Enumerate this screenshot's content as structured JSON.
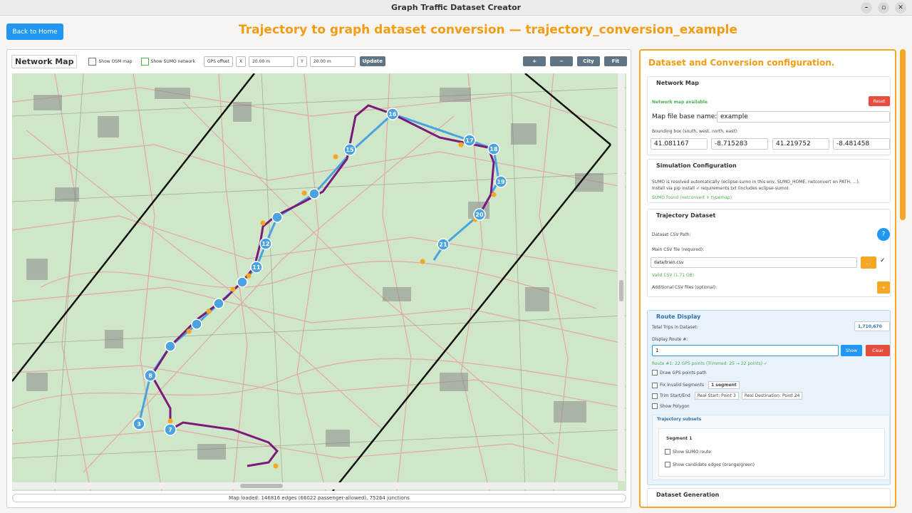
{
  "window": {
    "title": "Graph Traffic Dataset Creator",
    "minimize": "–",
    "maximize": "▫",
    "close": "✕"
  },
  "header": {
    "home_button": "Back to Home",
    "title": "Trajectory to graph dataset conversion — trajectory_conversion_example"
  },
  "map_toolbar": {
    "label": "Network Map",
    "show_osm": "Show OSM map",
    "show_sumo": "Show SUMO network",
    "gps_offset": "GPS offset",
    "x_label": "X",
    "x_value": "20.00 m",
    "y_label": "Y",
    "y_value": "20.00 m",
    "update": "Update",
    "zoom_in": "+",
    "zoom_out": "−",
    "city": "City",
    "fit": "Fit"
  },
  "map": {
    "status": "Map loaded: 146816 edges (66022 passenger-allowed), 75264 junctions",
    "point_labels": [
      "3",
      "7",
      "8",
      "11",
      "12",
      "15",
      "16",
      "17",
      "18",
      "19",
      "20",
      "21"
    ],
    "colors": {
      "background": "#cfe6c8",
      "roads": "#e3a3a3",
      "buildings": "#8a8a8a",
      "route": "#7b1a7b",
      "gps": "#4aa3df",
      "marker": "#f5a623",
      "bbox": "#111111"
    }
  },
  "config": {
    "title": "Dataset and Conversion configuration.",
    "network_map": {
      "heading": "Network Map",
      "status": "Network map available",
      "reset": "Reset",
      "base_name_label": "Map file base name:",
      "base_name_value": "example",
      "bbox_label": "Bounding box (south, west, north, east):",
      "bbox": [
        "41.081167",
        "-8.715283",
        "41.219752",
        "-8.481458"
      ]
    },
    "simulation": {
      "heading": "Simulation Configuration",
      "text1": "SUMO is resolved automatically (eclipse-sumo in this env, SUMO_HOME, netconvert on PATH, ...).",
      "text2": "Install via pip install -r requirements.txt (includes eclipse-sumo).",
      "status": "SUMO found (netconvert + typemap)"
    },
    "trajectory": {
      "heading": "Trajectory Dataset",
      "csv_label": "Dataset CSV Path:",
      "help": "?",
      "main_csv_label": "Main CSV file (required):",
      "main_csv_value": "data/train.csv",
      "browse": "...",
      "check": "✓",
      "valid": "Valid CSV (1.71 GB)",
      "additional": "Additional CSV files (optional):",
      "add": "+"
    },
    "route_display": {
      "heading": "Route Display",
      "total_label": "Total Trips in Dataset:",
      "total_value": "1,710,670",
      "route_label": "Display Route #:",
      "route_value": "1",
      "show": "Show",
      "clear": "Clear",
      "route_info": "Route #1: 22 GPS points (Trimmed: 25 → 22 points) ✓",
      "opt_gps": "Draw GPS points path",
      "opt_fix": "Fix Invalid Segments",
      "fix_count": "1 segment",
      "opt_trim": "Trim Start/End",
      "real_start": "Real Start: Point 3",
      "real_dest": "Real Destination: Point 24",
      "opt_polygon": "Show Polygon",
      "subsets_heading": "Trajectory subsets",
      "segment_title": "Segment 1",
      "seg_opt1": "Show SUMO route",
      "seg_opt2": "Show candidate edges (orange/green)"
    },
    "generation": {
      "heading": "Dataset Generation"
    }
  }
}
